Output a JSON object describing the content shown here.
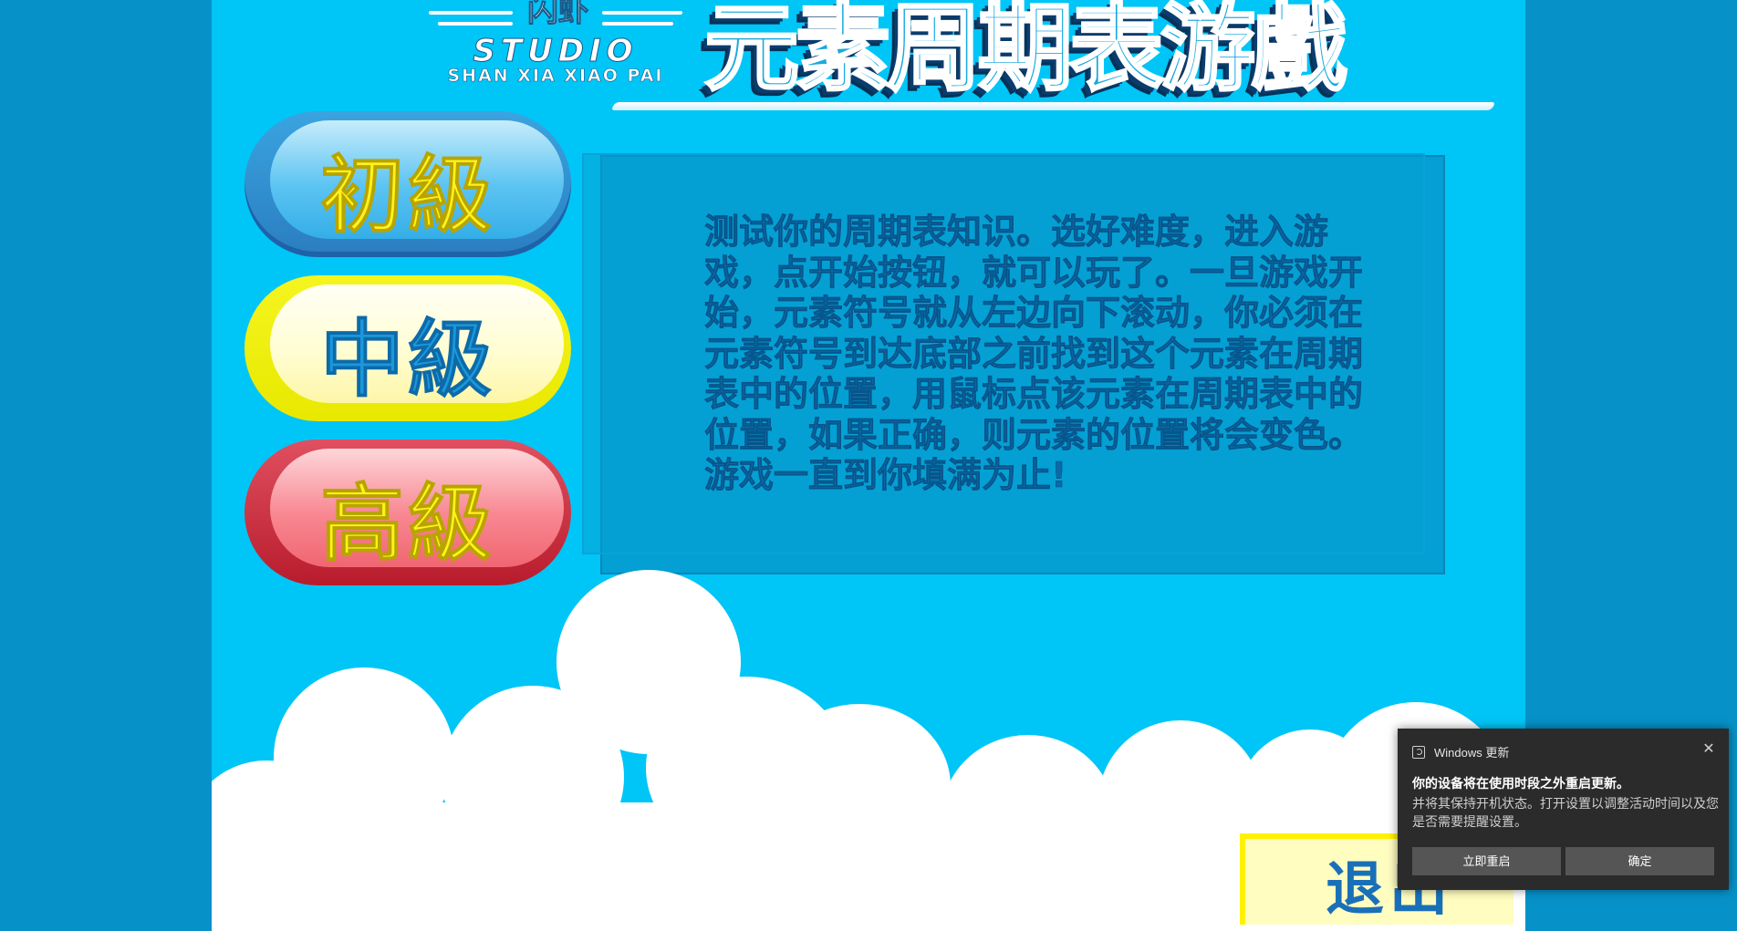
{
  "header": {
    "logo_top": "闪虾",
    "logo_studio": "STUDIO",
    "logo_sub": "SHAN XIA XIAO PAI",
    "title": "元素周期表游戲"
  },
  "levels": [
    {
      "label": "初級"
    },
    {
      "label": "中級"
    },
    {
      "label": "高級"
    }
  ],
  "instructions": "测试你的周期表知识。选好难度，进入游戏，点开始按钮，就可以玩了。一旦游戏开始，元素符号就从左边向下滚动，你必须在元素符号到达底部之前找到这个元素在周期表中的位置，用鼠标点该元素在周期表中的位置，如果正确，则元素的位置将会变色。游戏一直到你填满为止!",
  "quit_label": "退出",
  "notification": {
    "app": "Windows 更新",
    "title": "你的设备将在使用时段之外重启更新。",
    "body": "并将其保持开机状态。打开设置以调整活动时间以及您是否需要提醒设置。",
    "restart_button": "立即重启",
    "ok_button": "确定",
    "close_icon": "✕"
  }
}
